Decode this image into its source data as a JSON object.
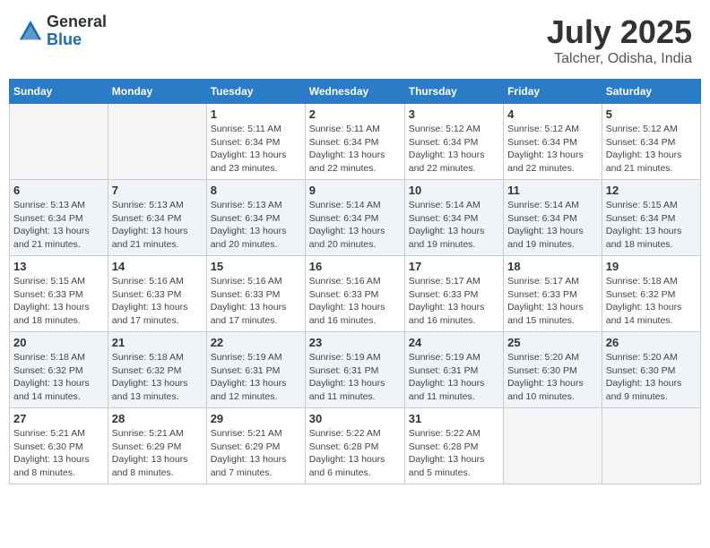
{
  "header": {
    "logo_general": "General",
    "logo_blue": "Blue",
    "month_title": "July 2025",
    "location": "Talcher, Odisha, India"
  },
  "weekdays": [
    "Sunday",
    "Monday",
    "Tuesday",
    "Wednesday",
    "Thursday",
    "Friday",
    "Saturday"
  ],
  "weeks": [
    [
      {
        "day": "",
        "detail": ""
      },
      {
        "day": "",
        "detail": ""
      },
      {
        "day": "1",
        "detail": "Sunrise: 5:11 AM\nSunset: 6:34 PM\nDaylight: 13 hours\nand 23 minutes."
      },
      {
        "day": "2",
        "detail": "Sunrise: 5:11 AM\nSunset: 6:34 PM\nDaylight: 13 hours\nand 22 minutes."
      },
      {
        "day": "3",
        "detail": "Sunrise: 5:12 AM\nSunset: 6:34 PM\nDaylight: 13 hours\nand 22 minutes."
      },
      {
        "day": "4",
        "detail": "Sunrise: 5:12 AM\nSunset: 6:34 PM\nDaylight: 13 hours\nand 22 minutes."
      },
      {
        "day": "5",
        "detail": "Sunrise: 5:12 AM\nSunset: 6:34 PM\nDaylight: 13 hours\nand 21 minutes."
      }
    ],
    [
      {
        "day": "6",
        "detail": "Sunrise: 5:13 AM\nSunset: 6:34 PM\nDaylight: 13 hours\nand 21 minutes."
      },
      {
        "day": "7",
        "detail": "Sunrise: 5:13 AM\nSunset: 6:34 PM\nDaylight: 13 hours\nand 21 minutes."
      },
      {
        "day": "8",
        "detail": "Sunrise: 5:13 AM\nSunset: 6:34 PM\nDaylight: 13 hours\nand 20 minutes."
      },
      {
        "day": "9",
        "detail": "Sunrise: 5:14 AM\nSunset: 6:34 PM\nDaylight: 13 hours\nand 20 minutes."
      },
      {
        "day": "10",
        "detail": "Sunrise: 5:14 AM\nSunset: 6:34 PM\nDaylight: 13 hours\nand 19 minutes."
      },
      {
        "day": "11",
        "detail": "Sunrise: 5:14 AM\nSunset: 6:34 PM\nDaylight: 13 hours\nand 19 minutes."
      },
      {
        "day": "12",
        "detail": "Sunrise: 5:15 AM\nSunset: 6:34 PM\nDaylight: 13 hours\nand 18 minutes."
      }
    ],
    [
      {
        "day": "13",
        "detail": "Sunrise: 5:15 AM\nSunset: 6:33 PM\nDaylight: 13 hours\nand 18 minutes."
      },
      {
        "day": "14",
        "detail": "Sunrise: 5:16 AM\nSunset: 6:33 PM\nDaylight: 13 hours\nand 17 minutes."
      },
      {
        "day": "15",
        "detail": "Sunrise: 5:16 AM\nSunset: 6:33 PM\nDaylight: 13 hours\nand 17 minutes."
      },
      {
        "day": "16",
        "detail": "Sunrise: 5:16 AM\nSunset: 6:33 PM\nDaylight: 13 hours\nand 16 minutes."
      },
      {
        "day": "17",
        "detail": "Sunrise: 5:17 AM\nSunset: 6:33 PM\nDaylight: 13 hours\nand 16 minutes."
      },
      {
        "day": "18",
        "detail": "Sunrise: 5:17 AM\nSunset: 6:33 PM\nDaylight: 13 hours\nand 15 minutes."
      },
      {
        "day": "19",
        "detail": "Sunrise: 5:18 AM\nSunset: 6:32 PM\nDaylight: 13 hours\nand 14 minutes."
      }
    ],
    [
      {
        "day": "20",
        "detail": "Sunrise: 5:18 AM\nSunset: 6:32 PM\nDaylight: 13 hours\nand 14 minutes."
      },
      {
        "day": "21",
        "detail": "Sunrise: 5:18 AM\nSunset: 6:32 PM\nDaylight: 13 hours\nand 13 minutes."
      },
      {
        "day": "22",
        "detail": "Sunrise: 5:19 AM\nSunset: 6:31 PM\nDaylight: 13 hours\nand 12 minutes."
      },
      {
        "day": "23",
        "detail": "Sunrise: 5:19 AM\nSunset: 6:31 PM\nDaylight: 13 hours\nand 11 minutes."
      },
      {
        "day": "24",
        "detail": "Sunrise: 5:19 AM\nSunset: 6:31 PM\nDaylight: 13 hours\nand 11 minutes."
      },
      {
        "day": "25",
        "detail": "Sunrise: 5:20 AM\nSunset: 6:30 PM\nDaylight: 13 hours\nand 10 minutes."
      },
      {
        "day": "26",
        "detail": "Sunrise: 5:20 AM\nSunset: 6:30 PM\nDaylight: 13 hours\nand 9 minutes."
      }
    ],
    [
      {
        "day": "27",
        "detail": "Sunrise: 5:21 AM\nSunset: 6:30 PM\nDaylight: 13 hours\nand 8 minutes."
      },
      {
        "day": "28",
        "detail": "Sunrise: 5:21 AM\nSunset: 6:29 PM\nDaylight: 13 hours\nand 8 minutes."
      },
      {
        "day": "29",
        "detail": "Sunrise: 5:21 AM\nSunset: 6:29 PM\nDaylight: 13 hours\nand 7 minutes."
      },
      {
        "day": "30",
        "detail": "Sunrise: 5:22 AM\nSunset: 6:28 PM\nDaylight: 13 hours\nand 6 minutes."
      },
      {
        "day": "31",
        "detail": "Sunrise: 5:22 AM\nSunset: 6:28 PM\nDaylight: 13 hours\nand 5 minutes."
      },
      {
        "day": "",
        "detail": ""
      },
      {
        "day": "",
        "detail": ""
      }
    ]
  ]
}
